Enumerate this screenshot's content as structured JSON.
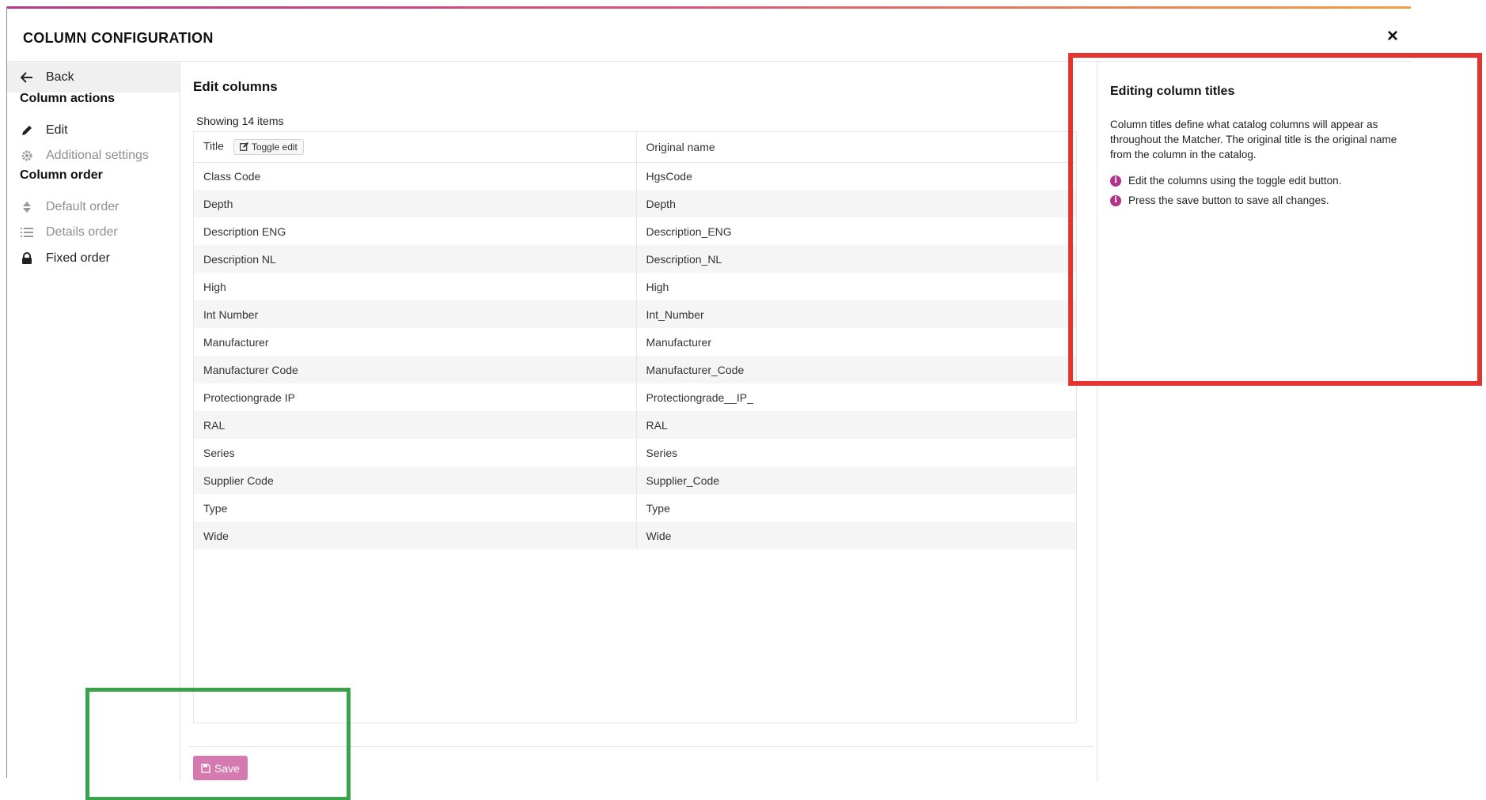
{
  "header": {
    "title": "COLUMN CONFIGURATION",
    "close_label": "×"
  },
  "sidebar": {
    "back_label": "Back",
    "section_actions": "Column actions",
    "edit_label": "Edit",
    "additional_settings_label": "Additional settings",
    "section_order": "Column order",
    "default_order_label": "Default order",
    "details_order_label": "Details order",
    "fixed_order_label": "Fixed order"
  },
  "main": {
    "heading": "Edit columns",
    "showing_text": "Showing 14 items",
    "columns": {
      "title": "Title",
      "toggle_edit": "Toggle edit",
      "original_name": "Original name"
    },
    "rows": [
      {
        "title": "Class Code",
        "original": "HgsCode"
      },
      {
        "title": "Depth",
        "original": "Depth"
      },
      {
        "title": "Description ENG",
        "original": "Description_ENG"
      },
      {
        "title": "Description NL",
        "original": "Description_NL"
      },
      {
        "title": "High",
        "original": "High"
      },
      {
        "title": "Int Number",
        "original": "Int_Number"
      },
      {
        "title": "Manufacturer",
        "original": "Manufacturer"
      },
      {
        "title": "Manufacturer Code",
        "original": "Manufacturer_Code"
      },
      {
        "title": "Protectiongrade IP",
        "original": "Protectiongrade__IP_"
      },
      {
        "title": "RAL",
        "original": "RAL"
      },
      {
        "title": "Series",
        "original": "Series"
      },
      {
        "title": "Supplier Code",
        "original": "Supplier_Code"
      },
      {
        "title": "Type",
        "original": "Type"
      },
      {
        "title": "Wide",
        "original": "Wide"
      }
    ],
    "save_label": "Save"
  },
  "info_panel": {
    "heading": "Editing column titles",
    "description": "Column titles define what catalog columns will appear as throughout the Matcher. The original title is the original name from the column in the catalog.",
    "tips": [
      "Edit the columns using the toggle edit button.",
      "Press the save button to save all changes."
    ]
  },
  "colors": {
    "accent": "#b0328a",
    "save_button": "#d57ab0",
    "highlight_red": "#e3342f",
    "highlight_green": "#3aa24a"
  }
}
